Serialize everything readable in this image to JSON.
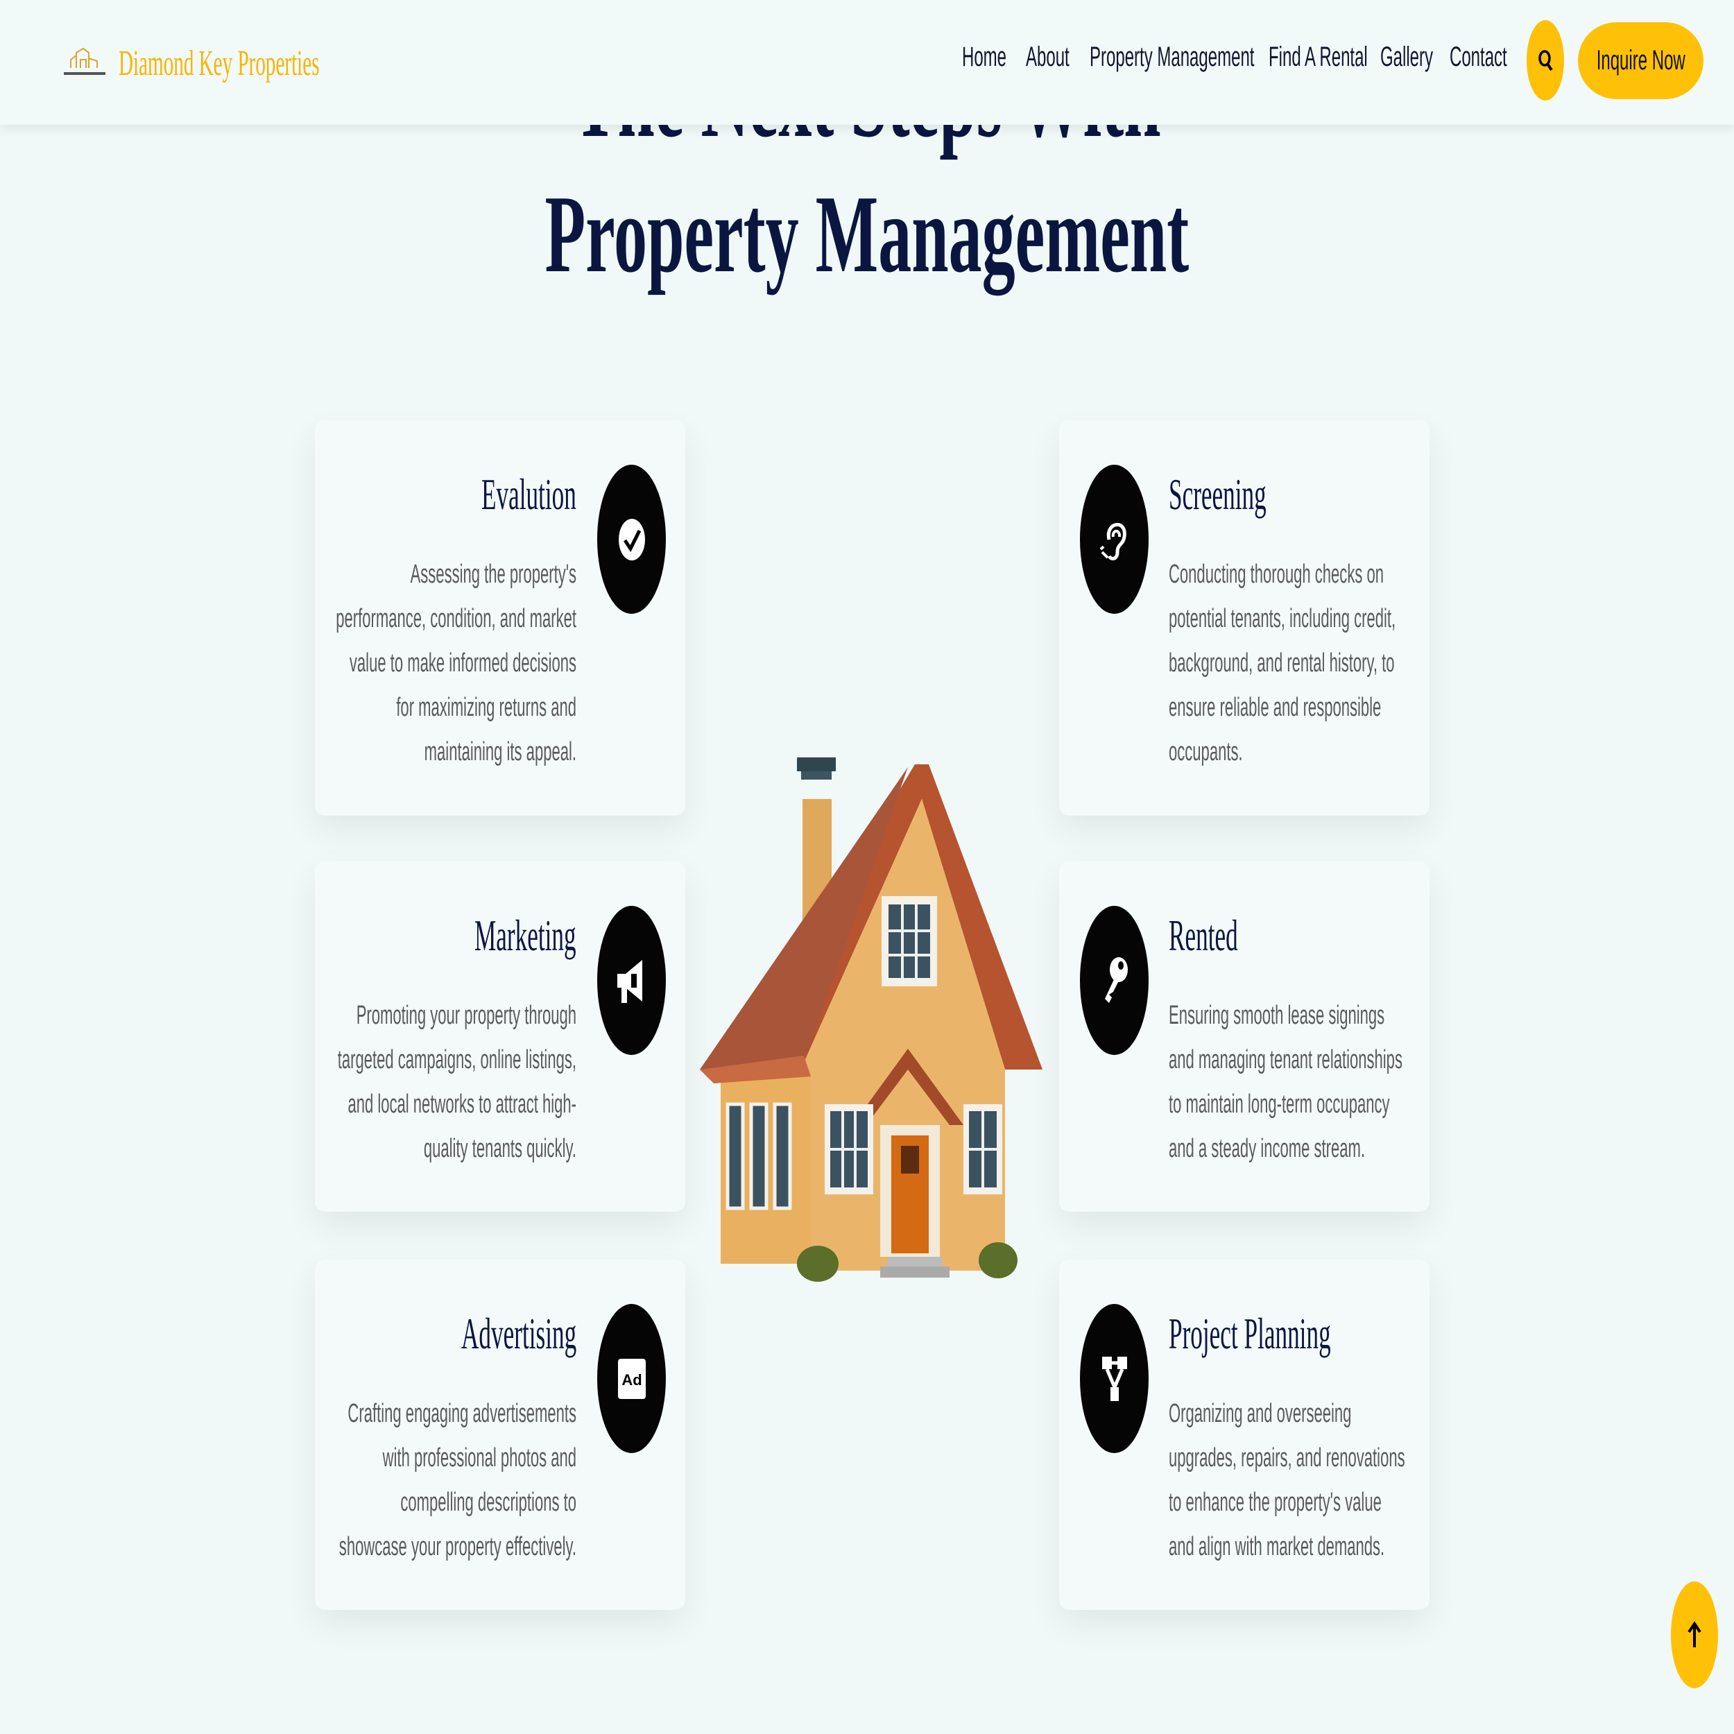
{
  "header": {
    "brand": "Diamond Key Properties",
    "nav": [
      "Home",
      "About",
      "Property Management",
      "Find A Rental",
      "Gallery",
      "Contact"
    ],
    "search_icon": "search-icon",
    "cta": "Inquire Now"
  },
  "hero": {
    "line1": "The Next Steps With",
    "line2": "Property Management"
  },
  "cards": [
    {
      "title": "Evalution",
      "icon": "check-badge-icon",
      "text": "Assessing the property's performance, condition, and market value to make informed decisions for maximizing returns and maintaining its appeal."
    },
    {
      "title": "Screening",
      "icon": "ear-icon",
      "text": "Conducting thorough checks on potential tenants, including credit, background, and rental history, to ensure reliable and responsible occupants."
    },
    {
      "title": "Marketing",
      "icon": "megaphone-icon",
      "text": "Promoting your property through targeted campaigns, online listings, and local networks to attract high-quality tenants quickly."
    },
    {
      "title": "Rented",
      "icon": "key-icon",
      "text": "Ensuring smooth lease signings and managing tenant relationships to maintain long-term occupancy and a steady income stream."
    },
    {
      "title": "Advertising",
      "icon": "ad-icon",
      "text": "Crafting engaging advertisements with professional photos and compelling descriptions to showcase your property effectively."
    },
    {
      "title": "Project Planning",
      "icon": "project-diagram-icon",
      "text": "Organizing and overseeing upgrades, repairs, and renovations to enhance the property's value and align with market demands."
    }
  ],
  "colors": {
    "accent": "#ffc107",
    "navy": "#0b1640",
    "background": "#f0f8f8"
  }
}
